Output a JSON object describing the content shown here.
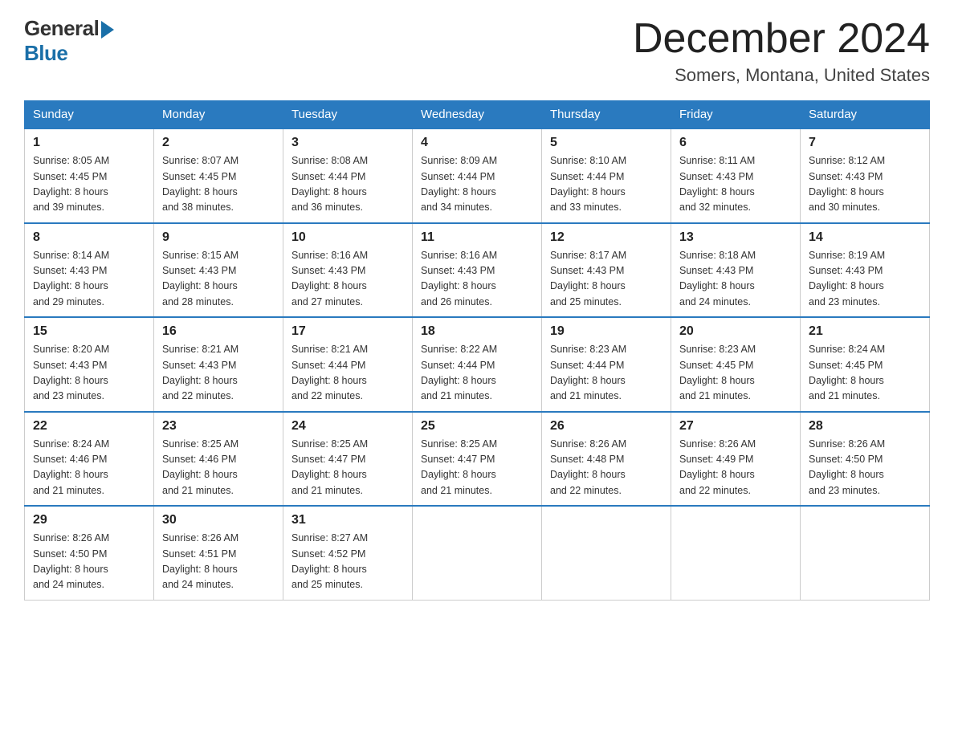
{
  "header": {
    "logo_general": "General",
    "logo_blue": "Blue",
    "month_title": "December 2024",
    "location": "Somers, Montana, United States"
  },
  "days_of_week": [
    "Sunday",
    "Monday",
    "Tuesday",
    "Wednesday",
    "Thursday",
    "Friday",
    "Saturday"
  ],
  "weeks": [
    [
      {
        "day": "1",
        "sunrise": "8:05 AM",
        "sunset": "4:45 PM",
        "daylight": "8 hours and 39 minutes."
      },
      {
        "day": "2",
        "sunrise": "8:07 AM",
        "sunset": "4:45 PM",
        "daylight": "8 hours and 38 minutes."
      },
      {
        "day": "3",
        "sunrise": "8:08 AM",
        "sunset": "4:44 PM",
        "daylight": "8 hours and 36 minutes."
      },
      {
        "day": "4",
        "sunrise": "8:09 AM",
        "sunset": "4:44 PM",
        "daylight": "8 hours and 34 minutes."
      },
      {
        "day": "5",
        "sunrise": "8:10 AM",
        "sunset": "4:44 PM",
        "daylight": "8 hours and 33 minutes."
      },
      {
        "day": "6",
        "sunrise": "8:11 AM",
        "sunset": "4:43 PM",
        "daylight": "8 hours and 32 minutes."
      },
      {
        "day": "7",
        "sunrise": "8:12 AM",
        "sunset": "4:43 PM",
        "daylight": "8 hours and 30 minutes."
      }
    ],
    [
      {
        "day": "8",
        "sunrise": "8:14 AM",
        "sunset": "4:43 PM",
        "daylight": "8 hours and 29 minutes."
      },
      {
        "day": "9",
        "sunrise": "8:15 AM",
        "sunset": "4:43 PM",
        "daylight": "8 hours and 28 minutes."
      },
      {
        "day": "10",
        "sunrise": "8:16 AM",
        "sunset": "4:43 PM",
        "daylight": "8 hours and 27 minutes."
      },
      {
        "day": "11",
        "sunrise": "8:16 AM",
        "sunset": "4:43 PM",
        "daylight": "8 hours and 26 minutes."
      },
      {
        "day": "12",
        "sunrise": "8:17 AM",
        "sunset": "4:43 PM",
        "daylight": "8 hours and 25 minutes."
      },
      {
        "day": "13",
        "sunrise": "8:18 AM",
        "sunset": "4:43 PM",
        "daylight": "8 hours and 24 minutes."
      },
      {
        "day": "14",
        "sunrise": "8:19 AM",
        "sunset": "4:43 PM",
        "daylight": "8 hours and 23 minutes."
      }
    ],
    [
      {
        "day": "15",
        "sunrise": "8:20 AM",
        "sunset": "4:43 PM",
        "daylight": "8 hours and 23 minutes."
      },
      {
        "day": "16",
        "sunrise": "8:21 AM",
        "sunset": "4:43 PM",
        "daylight": "8 hours and 22 minutes."
      },
      {
        "day": "17",
        "sunrise": "8:21 AM",
        "sunset": "4:44 PM",
        "daylight": "8 hours and 22 minutes."
      },
      {
        "day": "18",
        "sunrise": "8:22 AM",
        "sunset": "4:44 PM",
        "daylight": "8 hours and 21 minutes."
      },
      {
        "day": "19",
        "sunrise": "8:23 AM",
        "sunset": "4:44 PM",
        "daylight": "8 hours and 21 minutes."
      },
      {
        "day": "20",
        "sunrise": "8:23 AM",
        "sunset": "4:45 PM",
        "daylight": "8 hours and 21 minutes."
      },
      {
        "day": "21",
        "sunrise": "8:24 AM",
        "sunset": "4:45 PM",
        "daylight": "8 hours and 21 minutes."
      }
    ],
    [
      {
        "day": "22",
        "sunrise": "8:24 AM",
        "sunset": "4:46 PM",
        "daylight": "8 hours and 21 minutes."
      },
      {
        "day": "23",
        "sunrise": "8:25 AM",
        "sunset": "4:46 PM",
        "daylight": "8 hours and 21 minutes."
      },
      {
        "day": "24",
        "sunrise": "8:25 AM",
        "sunset": "4:47 PM",
        "daylight": "8 hours and 21 minutes."
      },
      {
        "day": "25",
        "sunrise": "8:25 AM",
        "sunset": "4:47 PM",
        "daylight": "8 hours and 21 minutes."
      },
      {
        "day": "26",
        "sunrise": "8:26 AM",
        "sunset": "4:48 PM",
        "daylight": "8 hours and 22 minutes."
      },
      {
        "day": "27",
        "sunrise": "8:26 AM",
        "sunset": "4:49 PM",
        "daylight": "8 hours and 22 minutes."
      },
      {
        "day": "28",
        "sunrise": "8:26 AM",
        "sunset": "4:50 PM",
        "daylight": "8 hours and 23 minutes."
      }
    ],
    [
      {
        "day": "29",
        "sunrise": "8:26 AM",
        "sunset": "4:50 PM",
        "daylight": "8 hours and 24 minutes."
      },
      {
        "day": "30",
        "sunrise": "8:26 AM",
        "sunset": "4:51 PM",
        "daylight": "8 hours and 24 minutes."
      },
      {
        "day": "31",
        "sunrise": "8:27 AM",
        "sunset": "4:52 PM",
        "daylight": "8 hours and 25 minutes."
      },
      null,
      null,
      null,
      null
    ]
  ],
  "labels": {
    "sunrise": "Sunrise:",
    "sunset": "Sunset:",
    "daylight": "Daylight:"
  }
}
